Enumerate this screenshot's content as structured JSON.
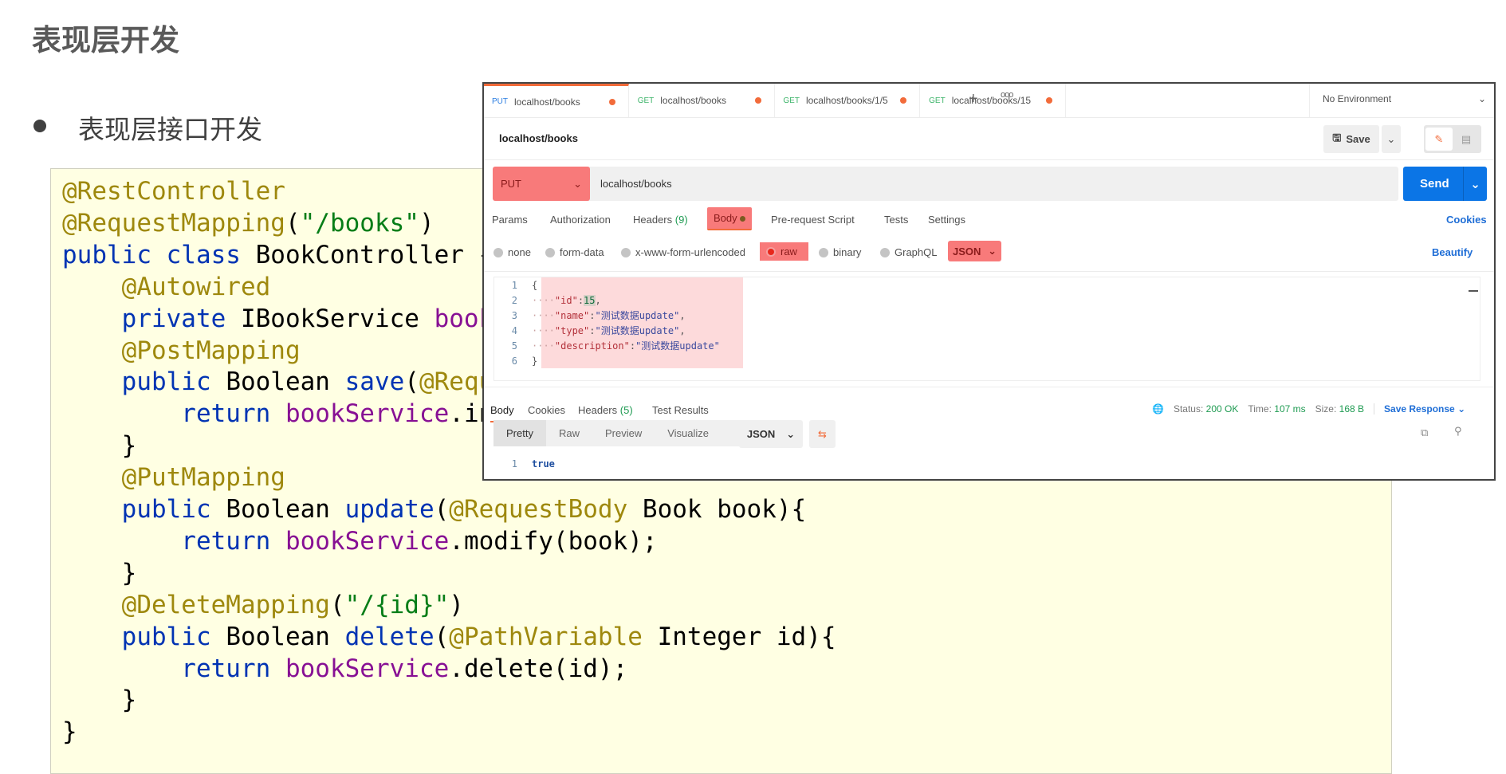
{
  "slide": {
    "title": "表现层开发",
    "bullet": "表现层接口开发"
  },
  "code": {
    "lines": [
      [
        [
          "an",
          "@RestController"
        ]
      ],
      [
        [
          "an",
          "@RequestMapping"
        ],
        [
          "tx",
          "("
        ],
        [
          "st",
          "\"/books\""
        ],
        [
          "tx",
          ")"
        ]
      ],
      [
        [
          "kw",
          "public class "
        ],
        [
          "tx",
          "BookController {"
        ]
      ],
      [
        [
          "an",
          "    @Autowired"
        ]
      ],
      [
        [
          "kw",
          "    private "
        ],
        [
          "tx",
          "IBookService "
        ],
        [
          "fd",
          "book"
        ]
      ],
      [
        [
          "an",
          "    @PostMapping"
        ]
      ],
      [
        [
          "kw",
          "    public "
        ],
        [
          "tx",
          "Boolean "
        ],
        [
          "kw",
          "save"
        ],
        [
          "tx",
          "("
        ],
        [
          "an",
          "@Requ"
        ]
      ],
      [
        [
          "kw",
          "        return "
        ],
        [
          "fd",
          "bookService"
        ],
        [
          "tx",
          ".in"
        ]
      ],
      [
        [
          "tx",
          "    }"
        ]
      ],
      [
        [
          "an",
          "    @PutMapping"
        ]
      ],
      [
        [
          "kw",
          "    public "
        ],
        [
          "tx",
          "Boolean "
        ],
        [
          "kw",
          "update"
        ],
        [
          "tx",
          "("
        ],
        [
          "an",
          "@RequestBody"
        ],
        [
          "tx",
          " Book book){"
        ]
      ],
      [
        [
          "kw",
          "        return "
        ],
        [
          "fd",
          "bookService"
        ],
        [
          "tx",
          ".modify(book);"
        ]
      ],
      [
        [
          "tx",
          "    }"
        ]
      ],
      [
        [
          "an",
          "    @DeleteMapping"
        ],
        [
          "tx",
          "("
        ],
        [
          "st",
          "\"/{id}\""
        ],
        [
          "tx",
          ")"
        ]
      ],
      [
        [
          "kw",
          "    public "
        ],
        [
          "tx",
          "Boolean "
        ],
        [
          "kw",
          "delete"
        ],
        [
          "tx",
          "("
        ],
        [
          "an",
          "@PathVariable"
        ],
        [
          "tx",
          " Integer id){"
        ]
      ],
      [
        [
          "kw",
          "        return "
        ],
        [
          "fd",
          "bookService"
        ],
        [
          "tx",
          ".delete(id);"
        ]
      ],
      [
        [
          "tx",
          "    }"
        ]
      ],
      [
        [
          "tx",
          "}"
        ]
      ]
    ]
  },
  "postman": {
    "tabs": [
      {
        "method": "PUT",
        "url": "localhost/books"
      },
      {
        "method": "GET",
        "url": "localhost/books"
      },
      {
        "method": "GET",
        "url": "localhost/books/1/5"
      },
      {
        "method": "GET",
        "url": "localhost/books/15"
      }
    ],
    "environment": "No Environment",
    "request_name": "localhost/books",
    "save": "Save",
    "method": "PUT",
    "url": "localhost/books",
    "send": "Send",
    "req_tabs": {
      "params": "Params",
      "auth": "Authorization",
      "headers": "Headers",
      "headers_count": "(9)",
      "body": "Body",
      "prereq": "Pre-request Script",
      "tests": "Tests",
      "settings": "Settings"
    },
    "cookies": "Cookies",
    "body_types": [
      "none",
      "form-data",
      "x-www-form-urlencoded",
      "raw",
      "binary",
      "GraphQL"
    ],
    "body_format": "JSON",
    "beautify": "Beautify",
    "body_lines": [
      [
        [
          "p",
          "{"
        ]
      ],
      [
        [
          "p",
          "····"
        ],
        [
          "k",
          "\"id\""
        ],
        [
          "p",
          ":"
        ],
        [
          "n",
          "15"
        ],
        [
          "p",
          ","
        ]
      ],
      [
        [
          "p",
          "····"
        ],
        [
          "k",
          "\"name\""
        ],
        [
          "p",
          ":"
        ],
        [
          "s",
          "\"测试数据update\""
        ],
        [
          "p",
          ","
        ]
      ],
      [
        [
          "p",
          "····"
        ],
        [
          "k",
          "\"type\""
        ],
        [
          "p",
          ":"
        ],
        [
          "s",
          "\"测试数据update\""
        ],
        [
          "p",
          ","
        ]
      ],
      [
        [
          "p",
          "····"
        ],
        [
          "k",
          "\"description\""
        ],
        [
          "p",
          ":"
        ],
        [
          "s",
          "\"测试数据update\""
        ]
      ],
      [
        [
          "p",
          "}"
        ]
      ]
    ],
    "resp_tabs": {
      "body": "Body",
      "cookies": "Cookies",
      "headers": "Headers",
      "headers_count": "(5)",
      "tests": "Test Results"
    },
    "status_label": "Status:",
    "status": "200 OK",
    "time_label": "Time:",
    "time": "107 ms",
    "size_label": "Size:",
    "size": "168 B",
    "save_response": "Save Response",
    "views": [
      "Pretty",
      "Raw",
      "Preview",
      "Visualize"
    ],
    "resp_format": "JSON",
    "response_lines": [
      "true"
    ]
  },
  "colors": {
    "accent": "#f26b3a",
    "send": "#0b75e6",
    "highlight": "#f87a7a"
  }
}
